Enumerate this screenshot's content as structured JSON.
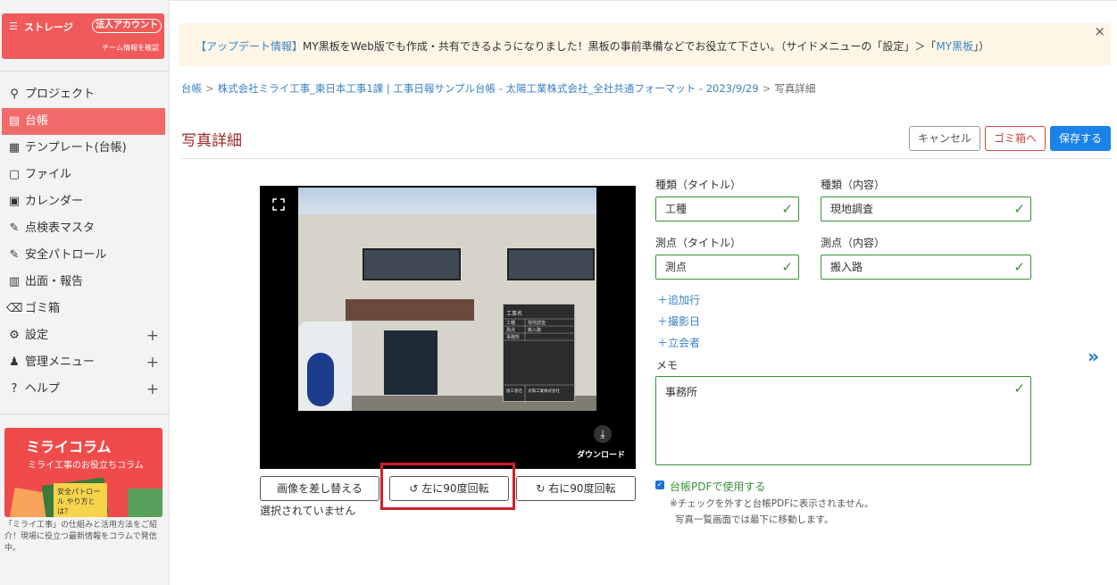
{
  "sidebar": {
    "storage": {
      "label": "ストレージ",
      "badge": "法人アカウント",
      "sub": "チーム情報を確認"
    },
    "items": [
      {
        "label": "プロジェクト",
        "icon": "project-icon"
      },
      {
        "label": "台帳",
        "icon": "ledger-icon",
        "active": true
      },
      {
        "label": "テンプレート(台帳)",
        "icon": "template-icon"
      },
      {
        "label": "ファイル",
        "icon": "file-icon"
      },
      {
        "label": "カレンダー",
        "icon": "calendar-icon"
      },
      {
        "label": "点検表マスタ",
        "icon": "checklist-icon"
      },
      {
        "label": "安全パトロール",
        "icon": "patrol-icon"
      },
      {
        "label": "出面・報告",
        "icon": "report-icon"
      },
      {
        "label": "ゴミ箱",
        "icon": "trash-icon"
      },
      {
        "label": "設定",
        "icon": "gear-icon",
        "expandable": true
      },
      {
        "label": "管理メニュー",
        "icon": "admin-icon",
        "expandable": true
      },
      {
        "label": "ヘルプ",
        "icon": "help-icon",
        "expandable": true
      }
    ],
    "banner": {
      "title": "ミライコラム",
      "sub": "ミライ工事のお役立ちコラム",
      "card": "安全パトロール やり方とは？",
      "text": "「ミライ工事」の仕組みと活用方法をご紹介！現場に役立つ最新情報をコラムで発信中。"
    }
  },
  "notice": {
    "link1": "【アップデート情報】",
    "text": "MY黒板をWeb版でも作成・共有できるようになりました！黒板の事前準備などでお役立て下さい。（サイドメニューの「設定」＞「",
    "link2": "MY黒板",
    "end": "」）",
    "close": "×"
  },
  "breadcrumb": {
    "root": "台帳",
    "sep": ">",
    "ledger": "株式会社ミライ工事_東日本工事1課 | 工事日報サンプル台帳 - 太陽工業株式会社_全社共通フォーマット - 2023/9/29",
    "current": "写真詳細"
  },
  "page": {
    "title": "写真詳細",
    "cancel": "キャンセル",
    "trash": "ゴミ箱へ",
    "save": "保存する"
  },
  "photo": {
    "download": "ダウンロード",
    "replace": "画像を差し替える",
    "rotate_left": "左に90度回転",
    "rotate_right": "右に90度回転",
    "status": "選択されていません",
    "board": {
      "title": "工事名",
      "row1_key": "工種",
      "row1_val": "現地調査",
      "row2_key": "測点",
      "row2_val": "搬入路",
      "row3_key": "事務所",
      "footer_key": "施工者名",
      "footer_val": "太陽工業株式会社"
    }
  },
  "form": {
    "type_title_label": "種類（タイトル）",
    "type_content_label": "種類（内容）",
    "type_title_value": "工種",
    "type_content_value": "現地調査",
    "point_title_label": "測点（タイトル）",
    "point_content_label": "測点（内容）",
    "point_title_value": "測点",
    "point_content_value": "搬入路",
    "add_row": "＋追加行",
    "add_date": "＋撮影日",
    "add_witness": "＋立会者",
    "memo_label": "メモ",
    "memo_value": "事務所",
    "pdf_label": "台帳PDFで使用する",
    "pdf_note1": "※チェックを外すと台帳PDFに表示されません。",
    "pdf_note2": "写真一覧画面では最下に移動します。",
    "check": "✓"
  },
  "icons": {
    "next": "»",
    "plus": "+",
    "download": "⤓",
    "rotate_left": "↺",
    "rotate_right": "↻"
  },
  "colors": {
    "accent_red": "#f26b6b",
    "save_blue": "#1a82e8",
    "valid_green": "#3a8f3a",
    "link_blue": "#3b82c4",
    "highlight": "#d01f2b"
  }
}
